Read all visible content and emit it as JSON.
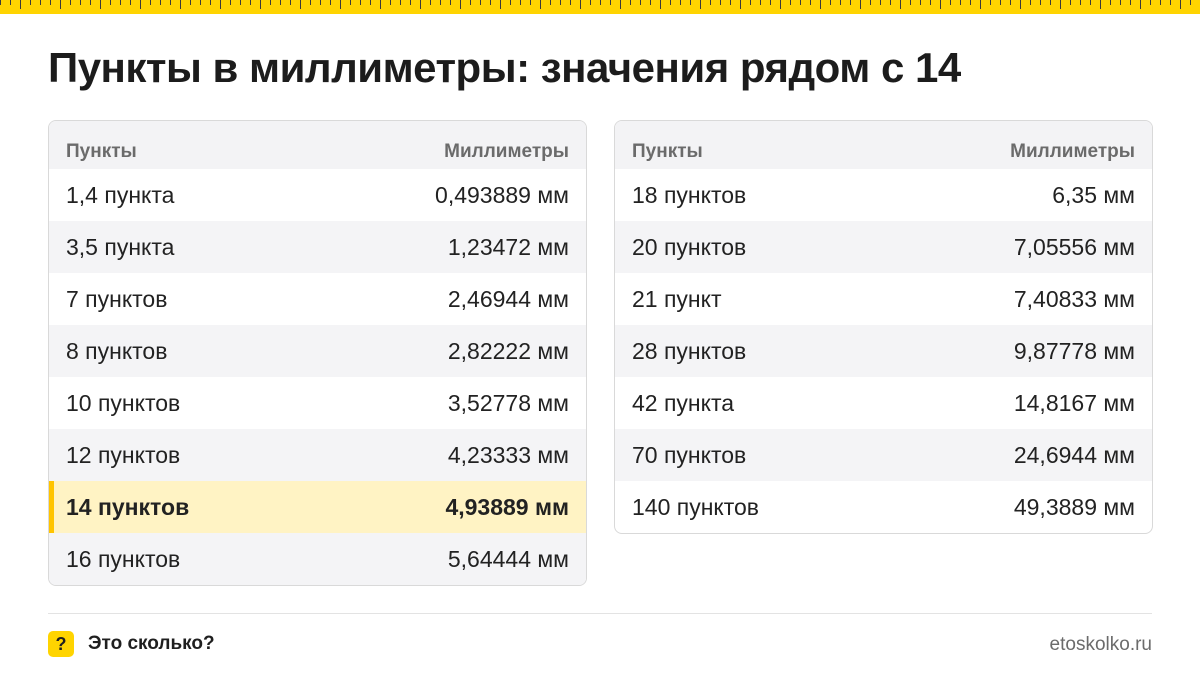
{
  "header": {
    "title": "Пункты в миллиметры: значения рядом с 14"
  },
  "colors": {
    "accent": "#ffd400",
    "highlight_row": "#fff3c4",
    "stripe": "#f4f4f6"
  },
  "tables": [
    {
      "col_left": "Пункты",
      "col_right": "Миллиметры",
      "rows": [
        {
          "points": "1,4 пункта",
          "mm": "0,493889 мм"
        },
        {
          "points": "3,5 пункта",
          "mm": "1,23472 мм"
        },
        {
          "points": "7 пунктов",
          "mm": "2,46944 мм"
        },
        {
          "points": "8 пунктов",
          "mm": "2,82222 мм"
        },
        {
          "points": "10 пунктов",
          "mm": "3,52778 мм"
        },
        {
          "points": "12 пунктов",
          "mm": "4,23333 мм"
        },
        {
          "points": "14 пунктов",
          "mm": "4,93889 мм",
          "highlighted": true
        },
        {
          "points": "16 пунктов",
          "mm": "5,64444 мм"
        }
      ]
    },
    {
      "col_left": "Пункты",
      "col_right": "Миллиметры",
      "rows": [
        {
          "points": "18 пунктов",
          "mm": "6,35 мм"
        },
        {
          "points": "20 пунктов",
          "mm": "7,05556 мм"
        },
        {
          "points": "21 пункт",
          "mm": "7,40833 мм"
        },
        {
          "points": "28 пунктов",
          "mm": "9,87778 мм"
        },
        {
          "points": "42 пункта",
          "mm": "14,8167 мм"
        },
        {
          "points": "70 пунктов",
          "mm": "24,6944 мм"
        },
        {
          "points": "140 пунктов",
          "mm": "49,3889 мм"
        }
      ]
    }
  ],
  "footer": {
    "brand_icon": "question-icon",
    "brand_icon_glyph": "?",
    "brand_name": "Это сколько?",
    "site": "etoskolko.ru"
  }
}
